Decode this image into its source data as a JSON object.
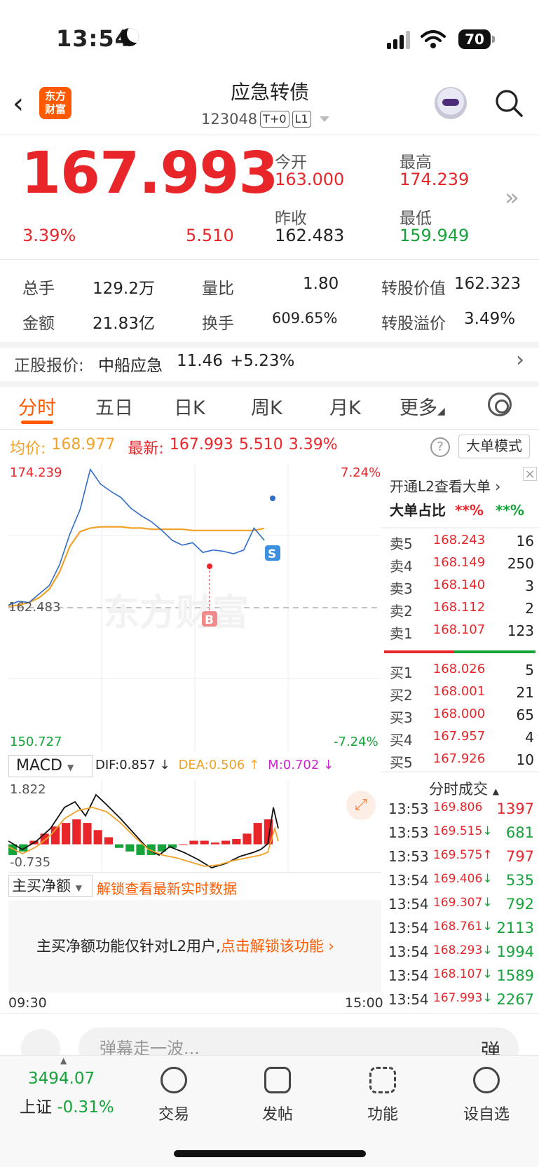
{
  "status_bar": {
    "time": "13:54",
    "battery": "70"
  },
  "header": {
    "logo_line1": "东方",
    "logo_line2": "财富",
    "title": "应急转债",
    "code": "123048",
    "tag1": "T+0",
    "tag2": "L1"
  },
  "quote": {
    "price": "167.993",
    "change_pct": "3.39%",
    "change": "5.510",
    "open_label": "今开",
    "open": "163.000",
    "high_label": "最高",
    "high": "174.239",
    "prev_close_label": "昨收",
    "prev_close": "162.483",
    "low_label": "最低",
    "low": "159.949"
  },
  "stats": {
    "volume_label": "总手",
    "volume": "129.2万",
    "ratio_label": "量比",
    "ratio": "1.80",
    "conv_value_label": "转股价值",
    "conv_value": "162.323",
    "amount_label": "金额",
    "amount": "21.83亿",
    "turnover_label": "换手",
    "turnover": "609.65%",
    "premium_label": "转股溢价",
    "premium": "3.49%"
  },
  "underlying": {
    "label": "正股报价:",
    "name": "中船应急",
    "price": "11.46",
    "change": "+5.23%"
  },
  "tabs": [
    "分时",
    "五日",
    "日K",
    "周K",
    "月K",
    "更多"
  ],
  "info": {
    "avg_label": "均价:",
    "avg": "168.977",
    "latest_label": "最新:",
    "latest": "167.993",
    "change": "5.510",
    "change_pct": "3.39%",
    "mode_button": "大单模式"
  },
  "chart_labels": {
    "top_price": "174.239",
    "top_pct": "7.24%",
    "mid_price": "162.483",
    "bottom_price": "150.727",
    "bottom_pct": "-7.24%",
    "watermark": "东方财富",
    "marker_s": "S",
    "marker_b": "B",
    "time_start": "09:30",
    "time_end": "15:00"
  },
  "order_book": {
    "l2_link": "开通L2查看大单",
    "big_order_label": "大单占比",
    "big_buy": "**%",
    "big_sell": "**%",
    "asks": [
      {
        "label": "卖5",
        "price": "168.243",
        "vol": "16"
      },
      {
        "label": "卖4",
        "price": "168.149",
        "vol": "250"
      },
      {
        "label": "卖3",
        "price": "168.140",
        "vol": "3"
      },
      {
        "label": "卖2",
        "price": "168.112",
        "vol": "2"
      },
      {
        "label": "卖1",
        "price": "168.107",
        "vol": "123"
      }
    ],
    "bids": [
      {
        "label": "买1",
        "price": "168.026",
        "vol": "5"
      },
      {
        "label": "买2",
        "price": "168.001",
        "vol": "21"
      },
      {
        "label": "买3",
        "price": "168.000",
        "vol": "65"
      },
      {
        "label": "买4",
        "price": "167.957",
        "vol": "4"
      },
      {
        "label": "买5",
        "price": "167.926",
        "vol": "10"
      }
    ]
  },
  "trades": {
    "title": "分时成交",
    "rows": [
      {
        "time": "13:53",
        "price": "169.806",
        "dir": "",
        "vol": "1397",
        "color": "red"
      },
      {
        "time": "13:53",
        "price": "169.515",
        "dir": "↓",
        "vol": "681",
        "color": "green"
      },
      {
        "time": "13:53",
        "price": "169.575",
        "dir": "↑",
        "vol": "797",
        "color": "red"
      },
      {
        "time": "13:54",
        "price": "169.406",
        "dir": "↓",
        "vol": "535",
        "color": "green"
      },
      {
        "time": "13:54",
        "price": "169.307",
        "dir": "↓",
        "vol": "792",
        "color": "green"
      },
      {
        "time": "13:54",
        "price": "168.761",
        "dir": "↓",
        "vol": "2113",
        "color": "green"
      },
      {
        "time": "13:54",
        "price": "168.293",
        "dir": "↓",
        "vol": "1994",
        "color": "green"
      },
      {
        "time": "13:54",
        "price": "168.107",
        "dir": "↓",
        "vol": "1589",
        "color": "green"
      },
      {
        "time": "13:54",
        "price": "167.993",
        "dir": "↓",
        "vol": "2267",
        "color": "green"
      }
    ]
  },
  "macd": {
    "selector": "MACD",
    "dif": "DIF:0.857 ↓",
    "dea": "DEA:0.506 ↑",
    "m": "M:0.702 ↓",
    "top": "1.822",
    "bottom": "-0.735"
  },
  "net_buy": {
    "selector": "主买净额",
    "unlock": "解锁查看最新实时数据",
    "notice": "主买净额功能仅针对L2用户,",
    "notice_link": "点击解锁该功能"
  },
  "comment": {
    "placeholder": "弹幕走一波...",
    "danmu": "弹"
  },
  "bottom_nav": {
    "index_value": "3494.07",
    "index_name": "上证",
    "index_change": "-0.31%",
    "items": [
      "交易",
      "发帖",
      "功能",
      "设自选"
    ]
  },
  "colors": {
    "up": "#e8262a",
    "down": "#16a33a",
    "avg_line": "#f0a22a",
    "price_line": "#2f6cc7",
    "accent": "#ff5a00"
  },
  "chart_data": [
    {
      "type": "line",
      "title": "",
      "series": [
        {
          "name": "",
          "values": [
            162.7,
            163.0,
            162.9,
            163.6,
            164.3,
            166.0,
            168.5,
            170.5,
            173.8,
            172.6,
            172.0,
            171.5,
            170.6,
            170.0,
            169.5,
            168.8,
            168.0,
            167.6,
            167.8,
            167.0,
            167.2,
            167.1,
            166.9,
            167.2,
            169.0,
            167.993
          ]
        },
        {
          "name": "",
          "values": [
            162.6,
            162.7,
            162.9,
            163.3,
            164.0,
            165.4,
            167.5,
            168.7,
            169.0,
            169.1,
            169.1,
            169.1,
            169.0,
            169.0,
            168.9,
            168.9,
            168.9,
            168.9,
            168.8,
            168.8,
            168.8,
            168.8,
            168.8,
            168.8,
            168.8,
            168.977
          ]
        }
      ],
      "ylim": [
        150.727,
        174.239
      ]
    },
    {
      "type": "bar",
      "title": "",
      "values": [
        -0.3,
        -0.2,
        0.1,
        0.3,
        0.5,
        0.6,
        0.7,
        0.6,
        0.4,
        0.2,
        -0.1,
        -0.2,
        -0.3,
        -0.3,
        -0.2,
        -0.1,
        0.0,
        0.1,
        0.1,
        0.05,
        0.1,
        0.15,
        0.3,
        0.6,
        0.7
      ],
      "ylim": [
        -0.735,
        1.822
      ]
    }
  ]
}
